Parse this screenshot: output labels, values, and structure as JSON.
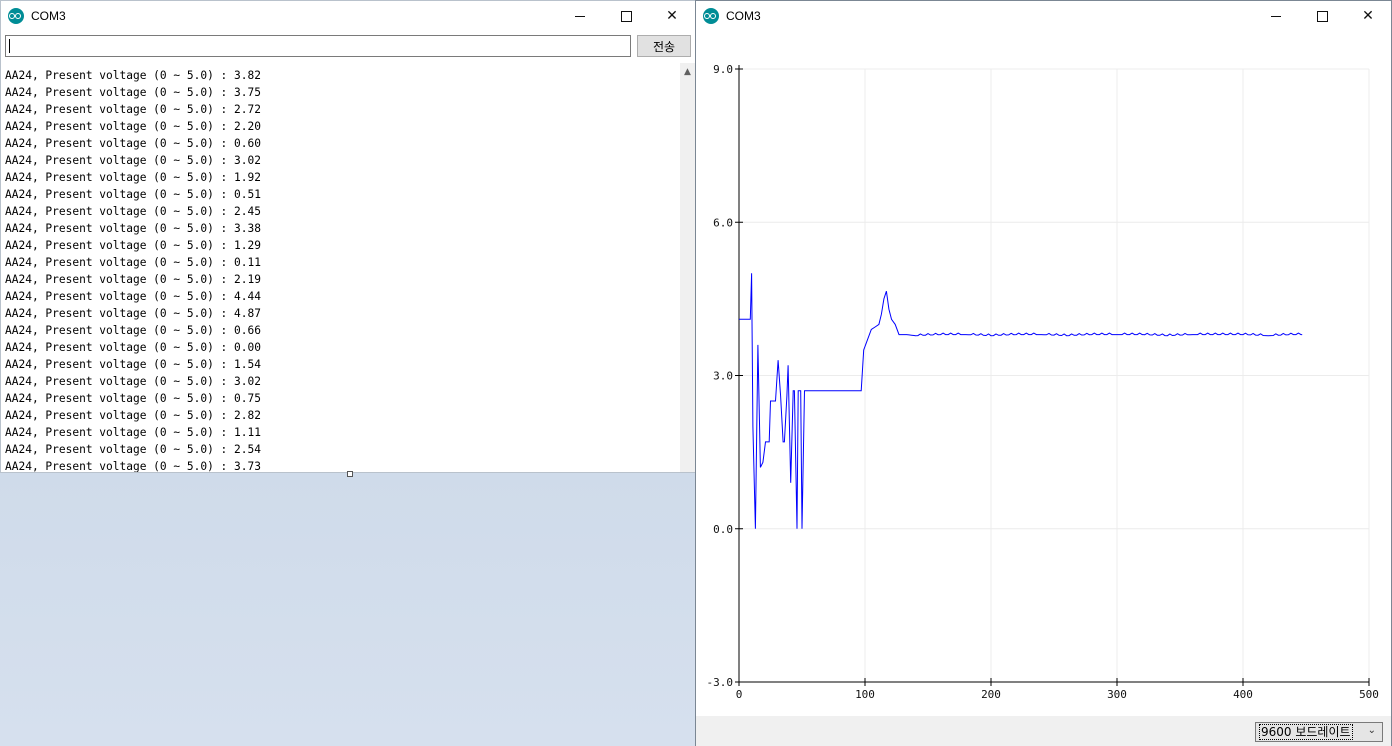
{
  "monitor": {
    "title": "COM3",
    "controls": {
      "minimize": "minimize",
      "maximize": "maximize",
      "close": "✕"
    },
    "input_value": "",
    "send_label": "전송",
    "lines": [
      "AA24, Present voltage (0 ~ 5.0) : 3.82",
      "AA24, Present voltage (0 ~ 5.0) : 3.75",
      "AA24, Present voltage (0 ~ 5.0) : 2.72",
      "AA24, Present voltage (0 ~ 5.0) : 2.20",
      "AA24, Present voltage (0 ~ 5.0) : 0.60",
      "AA24, Present voltage (0 ~ 5.0) : 3.02",
      "AA24, Present voltage (0 ~ 5.0) : 1.92",
      "AA24, Present voltage (0 ~ 5.0) : 0.51",
      "AA24, Present voltage (0 ~ 5.0) : 2.45",
      "AA24, Present voltage (0 ~ 5.0) : 3.38",
      "AA24, Present voltage (0 ~ 5.0) : 1.29",
      "AA24, Present voltage (0 ~ 5.0) : 0.11",
      "AA24, Present voltage (0 ~ 5.0) : 2.19",
      "AA24, Present voltage (0 ~ 5.0) : 4.44",
      "AA24, Present voltage (0 ~ 5.0) : 4.87",
      "AA24, Present voltage (0 ~ 5.0) : 0.66",
      "AA24, Present voltage (0 ~ 5.0) : 0.00",
      "AA24, Present voltage (0 ~ 5.0) : 1.54",
      "AA24, Present voltage (0 ~ 5.0) : 3.02",
      "AA24, Present voltage (0 ~ 5.0) : 0.75",
      "AA24, Present voltage (0 ~ 5.0) : 2.82",
      "AA24, Present voltage (0 ~ 5.0) : 1.11",
      "AA24, Present voltage (0 ~ 5.0) : 2.54",
      "AA24, Present voltage (0 ~ 5.0) : 3.73"
    ]
  },
  "plotter": {
    "title": "COM3",
    "controls": {
      "minimize": "minimize",
      "maximize": "maximize",
      "close": "✕"
    },
    "baud_label": "9600 보드레이트",
    "line_color": "#0000ff"
  },
  "chart_data": {
    "type": "line",
    "title": "",
    "xlabel": "",
    "ylabel": "",
    "xlim": [
      0,
      500
    ],
    "ylim": [
      -3.0,
      9.0
    ],
    "x_ticks": [
      "0",
      "100",
      "200",
      "300",
      "400",
      "500"
    ],
    "y_ticks": [
      "-3.0",
      "0.0",
      "3.0",
      "6.0",
      "9.0"
    ],
    "grid": true,
    "series": [
      {
        "x": [
          0,
          9,
          10,
          11,
          13,
          15,
          17,
          19,
          21,
          24,
          25,
          27,
          29,
          31,
          33,
          35,
          36,
          38,
          39,
          41,
          43,
          44,
          46,
          47,
          49,
          50,
          52,
          53,
          55,
          57,
          58,
          60,
          61,
          63,
          65,
          97,
          99,
          102,
          105,
          108,
          111,
          113,
          115,
          117,
          119,
          121,
          124,
          127,
          130,
          133,
          140,
          160,
          180,
          200,
          220,
          240,
          260,
          280,
          300,
          320,
          340,
          360,
          380,
          400,
          420,
          440,
          447
        ],
        "y": [
          4.1,
          4.1,
          5.0,
          2.0,
          0.0,
          3.6,
          1.2,
          1.3,
          1.7,
          1.7,
          2.5,
          2.5,
          2.5,
          3.3,
          2.6,
          1.7,
          1.7,
          2.6,
          3.2,
          0.9,
          2.7,
          2.7,
          0.0,
          2.7,
          2.7,
          0.0,
          2.7,
          2.7,
          2.7,
          2.7,
          2.7,
          2.7,
          2.7,
          2.7,
          2.7,
          2.7,
          3.5,
          3.7,
          3.9,
          3.95,
          4.0,
          4.2,
          4.5,
          4.65,
          4.3,
          4.1,
          4.0,
          3.8,
          3.8,
          3.8,
          3.78,
          3.8,
          3.8,
          3.78,
          3.8,
          3.8,
          3.78,
          3.8,
          3.8,
          3.8,
          3.78,
          3.8,
          3.8,
          3.8,
          3.78,
          3.8,
          3.8
        ]
      }
    ]
  }
}
